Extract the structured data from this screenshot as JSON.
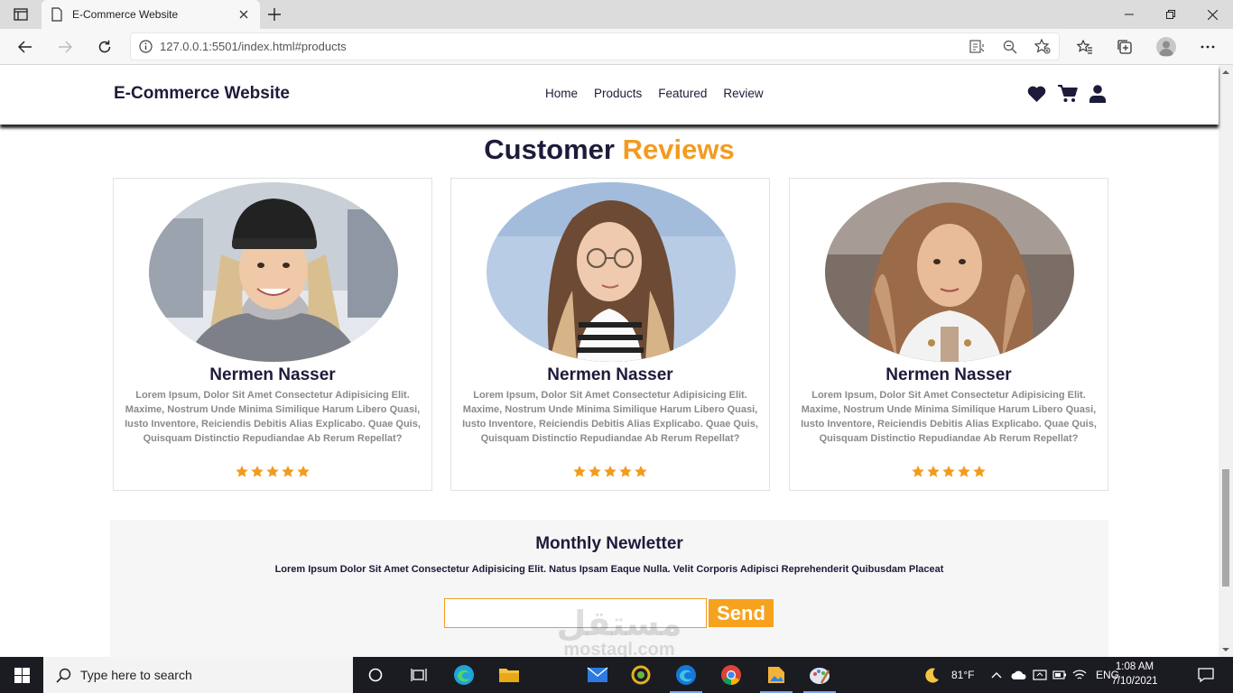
{
  "browser": {
    "tab_title": "E-Commerce Website",
    "url": "127.0.0.1:5501/index.html#products"
  },
  "site": {
    "logo": "E-Commerce Website",
    "nav": [
      "Home",
      "Products",
      "Featured",
      "Review"
    ]
  },
  "reviews": {
    "heading_main": "Customer",
    "heading_accent": "Reviews",
    "cards": [
      {
        "name": "Nermen Nasser",
        "text": "Lorem Ipsum, Dolor Sit Amet Consectetur Adipisicing Elit. Maxime, Nostrum Unde Minima Similique Harum Libero Quasi, Iusto Inventore, Reiciendis Debitis Alias Explicabo. Quae Quis, Quisquam Distinctio Repudiandae Ab Rerum Repellat?",
        "rating": 5
      },
      {
        "name": "Nermen Nasser",
        "text": "Lorem Ipsum, Dolor Sit Amet Consectetur Adipisicing Elit. Maxime, Nostrum Unde Minima Similique Harum Libero Quasi, Iusto Inventore, Reiciendis Debitis Alias Explicabo. Quae Quis, Quisquam Distinctio Repudiandae Ab Rerum Repellat?",
        "rating": 5
      },
      {
        "name": "Nermen Nasser",
        "text": "Lorem Ipsum, Dolor Sit Amet Consectetur Adipisicing Elit. Maxime, Nostrum Unde Minima Similique Harum Libero Quasi, Iusto Inventore, Reiciendis Debitis Alias Explicabo. Quae Quis, Quisquam Distinctio Repudiandae Ab Rerum Repellat?",
        "rating": 5
      }
    ]
  },
  "newsletter": {
    "title": "Monthly Newletter",
    "text": "Lorem Ipsum Dolor Sit Amet Consectetur Adipisicing Elit. Natus Ipsam Eaque Nulla. Velit Corporis Adipisci Reprehenderit Quibusdam Placeat",
    "input_value": "",
    "button": "Send"
  },
  "watermark": {
    "arabic": "مستقل",
    "latin": "mostaql.com"
  },
  "taskbar": {
    "search_placeholder": "Type here to search",
    "weather": "81°F",
    "language": "ENG",
    "time": "1:08 AM",
    "date": "7/10/2021"
  },
  "colors": {
    "accent": "#f29b1f",
    "dark": "#1d1b3a",
    "muted_text": "#8a8a8a"
  }
}
